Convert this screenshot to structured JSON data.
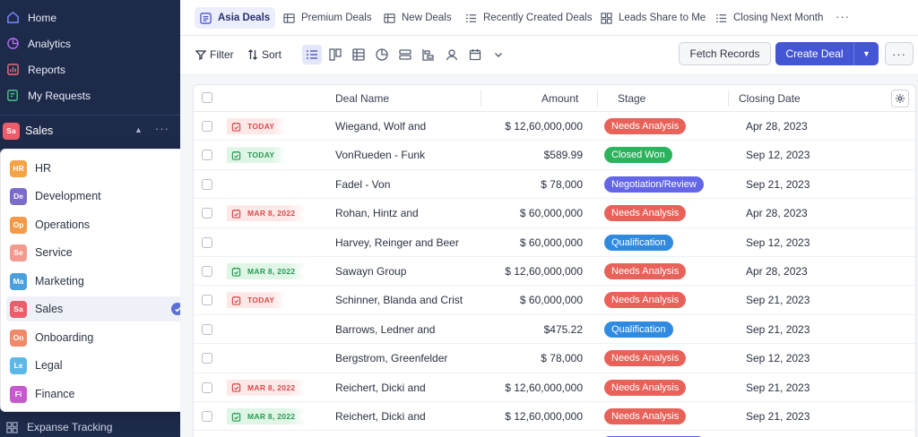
{
  "sidebar": {
    "nav": [
      {
        "label": "Home",
        "icon": "home-icon"
      },
      {
        "label": "Analytics",
        "icon": "analytics-icon"
      },
      {
        "label": "Reports",
        "icon": "reports-icon"
      },
      {
        "label": "My Requests",
        "icon": "requests-icon"
      }
    ],
    "workspace": {
      "badge": "Sa",
      "label": "Sales"
    },
    "dropdown": [
      {
        "badge": "HR",
        "label": "HR",
        "color": "#f4a444"
      },
      {
        "badge": "De",
        "label": "Development",
        "color": "#7d6bc9"
      },
      {
        "badge": "Op",
        "label": "Operations",
        "color": "#f39a4a"
      },
      {
        "badge": "Se",
        "label": "Service",
        "color": "#f59a8e"
      },
      {
        "badge": "Ma",
        "label": "Marketing",
        "color": "#4b9fdc"
      },
      {
        "badge": "Sa",
        "label": "Sales",
        "color": "#ec5d6b",
        "selected": true
      },
      {
        "badge": "On",
        "label": "Onboarding",
        "color": "#f08a6a"
      },
      {
        "badge": "Le",
        "label": "Legal",
        "color": "#5cb8e8"
      },
      {
        "badge": "Fi",
        "label": "Finance",
        "color": "#c85ad0"
      }
    ],
    "bottom_item": "Expanse Tracking"
  },
  "tabs": [
    {
      "label": "Asia Deals",
      "active": true
    },
    {
      "label": "Premium Deals"
    },
    {
      "label": "New Deals"
    },
    {
      "label": "Recently Created Deals"
    },
    {
      "label": "Leads Share to Me"
    },
    {
      "label": "Closing Next Month"
    }
  ],
  "toolbar": {
    "filter": "Filter",
    "sort": "Sort",
    "fetch": "Fetch Records",
    "create": "Create Deal"
  },
  "table": {
    "columns": [
      "Deal Name",
      "Amount",
      "Stage",
      "Closing Date"
    ],
    "rows": [
      {
        "tag": "TODAY",
        "tag_color": "red",
        "name": "Wiegand, Wolf and",
        "amount": "$ 12,60,000,000",
        "stage": "Needs Analysis",
        "stage_color": "#e8625a",
        "date": "Apr 28, 2023"
      },
      {
        "tag": "TODAY",
        "tag_color": "green",
        "name": "VonRueden - Funk",
        "amount": "$589.99",
        "stage": "Closed Won",
        "stage_color": "#2bb35e",
        "date": "Sep 12, 2023"
      },
      {
        "tag": "",
        "tag_color": "",
        "name": "Fadel - Von",
        "amount": "$ 78,000",
        "stage": "Negotiation/Review",
        "stage_color": "#6366e8",
        "date": "Sep 21, 2023"
      },
      {
        "tag": "MAR 8, 2022",
        "tag_color": "red",
        "name": "Rohan, Hintz and",
        "amount": "$ 60,000,000",
        "stage": "Needs Analysis",
        "stage_color": "#e8625a",
        "date": "Apr 28, 2023"
      },
      {
        "tag": "",
        "tag_color": "",
        "name": "Harvey, Reinger and Beer",
        "amount": "$ 60,000,000",
        "stage": "Qualification",
        "stage_color": "#2f8ae0",
        "date": "Sep 12, 2023"
      },
      {
        "tag": "MAR 8, 2022",
        "tag_color": "green",
        "name": "Sawayn Group",
        "amount": "$ 12,60,000,000",
        "stage": "Needs Analysis",
        "stage_color": "#e8625a",
        "date": "Apr 28, 2023"
      },
      {
        "tag": "TODAY",
        "tag_color": "red",
        "name": "Schinner, Blanda and Crist",
        "amount": "$ 60,000,000",
        "stage": "Needs Analysis",
        "stage_color": "#e8625a",
        "date": "Sep 21, 2023"
      },
      {
        "tag": "",
        "tag_color": "",
        "name": "Barrows, Ledner and",
        "amount": "$475.22",
        "stage": "Qualification",
        "stage_color": "#2f8ae0",
        "date": "Sep 21, 2023"
      },
      {
        "tag": "",
        "tag_color": "",
        "name": "Bergstrom, Greenfelder",
        "amount": "$ 78,000",
        "stage": "Needs Analysis",
        "stage_color": "#e8625a",
        "date": "Sep 12, 2023"
      },
      {
        "tag": "MAR 8, 2022",
        "tag_color": "red",
        "name": "Reichert, Dicki and",
        "amount": "$ 12,60,000,000",
        "stage": "Needs Analysis",
        "stage_color": "#e8625a",
        "date": "Sep 21, 2023"
      },
      {
        "tag": "MAR 8, 2022",
        "tag_color": "green",
        "name": "Reichert, Dicki and",
        "amount": "$ 12,60,000,000",
        "stage": "Needs Analysis",
        "stage_color": "#e8625a",
        "date": "Sep 21, 2023"
      }
    ]
  }
}
